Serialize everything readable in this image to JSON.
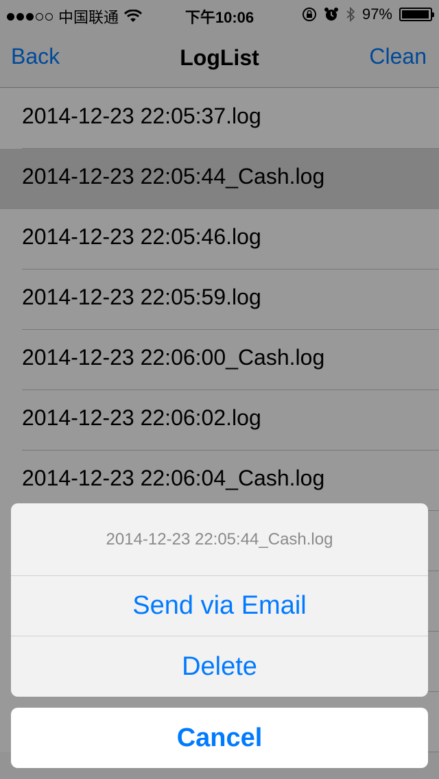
{
  "status_bar": {
    "carrier": "中国联通",
    "time": "下午10:06",
    "battery": "97%",
    "battery_level": 0.97,
    "signal_dots_filled": 3,
    "signal_dots_total": 5
  },
  "navbar": {
    "back_label": "Back",
    "title": "LogList",
    "clean_label": "Clean"
  },
  "log_list": {
    "items": [
      {
        "label": "2014-12-23 22:05:37.log",
        "selected": false
      },
      {
        "label": "2014-12-23 22:05:44_Cash.log",
        "selected": true
      },
      {
        "label": "2014-12-23 22:05:46.log",
        "selected": false
      },
      {
        "label": "2014-12-23 22:05:59.log",
        "selected": false
      },
      {
        "label": "2014-12-23 22:06:00_Cash.log",
        "selected": false
      },
      {
        "label": "2014-12-23 22:06:02.log",
        "selected": false
      },
      {
        "label": "2014-12-23 22:06:04_Cash.log",
        "selected": false
      }
    ]
  },
  "action_sheet": {
    "title": "2014-12-23 22:05:44_Cash.log",
    "buttons": [
      {
        "label": "Send via Email"
      },
      {
        "label": "Delete"
      }
    ],
    "cancel_label": "Cancel"
  },
  "colors": {
    "accent": "#007aff"
  }
}
